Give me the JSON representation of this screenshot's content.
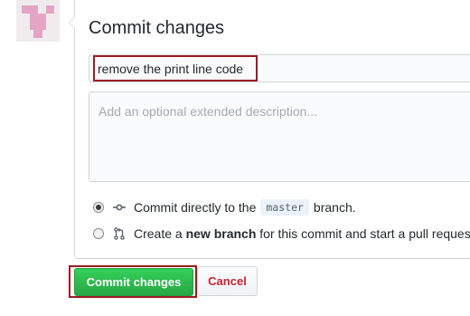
{
  "avatar": {
    "icon": "identicon",
    "color": "#e6a4c4"
  },
  "form": {
    "title": "Commit changes",
    "summary_value": "remove the print line code",
    "description_placeholder": "Add an optional extended description...",
    "options": [
      {
        "selected": true,
        "icon": "git-commit-icon",
        "prefix": "Commit directly to the",
        "branch": "master",
        "suffix": "branch."
      },
      {
        "selected": false,
        "icon": "git-pull-request-icon",
        "prefix": "Create a",
        "emphasis": "new branch",
        "suffix": "for this commit and start a pull request."
      }
    ],
    "commit_label": "Commit changes",
    "cancel_label": "Cancel"
  },
  "colors": {
    "primary_button": "#2cbe4e",
    "cancel_text": "#cb2431",
    "highlight_box": "#9c1b22"
  }
}
